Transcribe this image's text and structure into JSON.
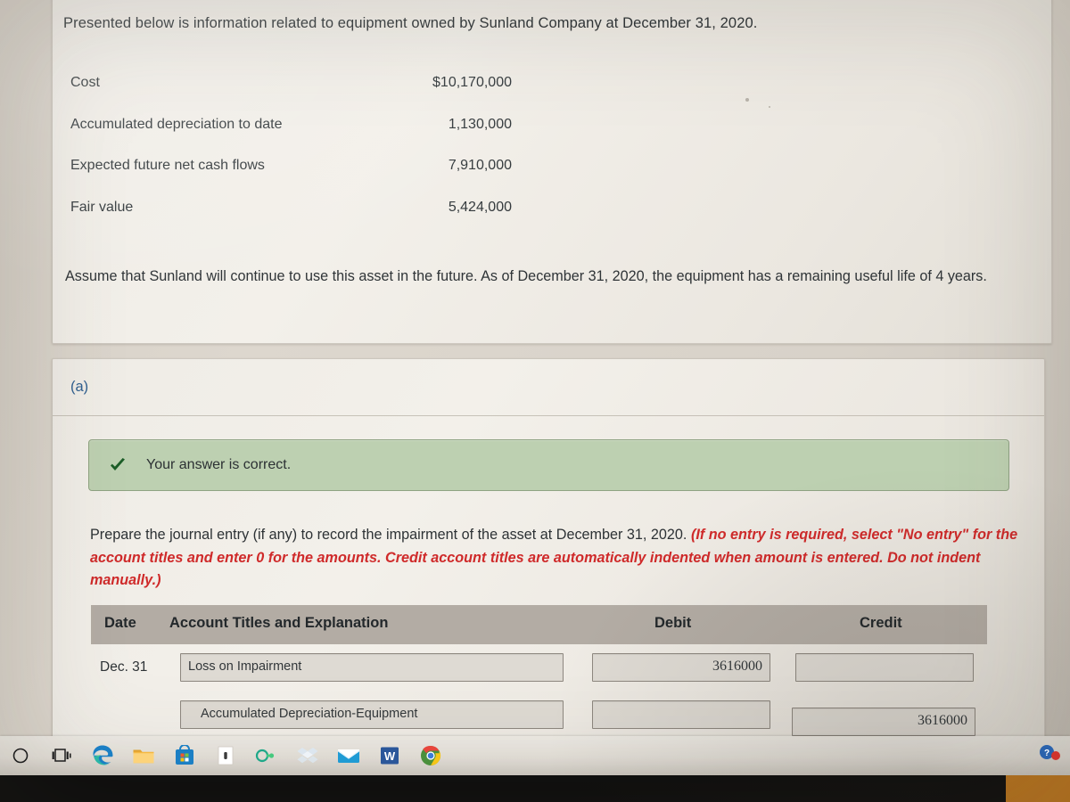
{
  "intro": {
    "text": "Presented below is information related to equipment owned by Sunland Company at December 31, 2020."
  },
  "equipment_info": {
    "rows": [
      {
        "label": "Cost",
        "value": "$10,170,000"
      },
      {
        "label": "Accumulated depreciation to date",
        "value": "1,130,000"
      },
      {
        "label": "Expected future net cash flows",
        "value": "7,910,000"
      },
      {
        "label": "Fair value",
        "value": "5,424,000"
      }
    ]
  },
  "assumption": {
    "text": "Assume that Sunland will continue to use this asset in the future. As of December 31, 2020, the equipment has a remaining useful life of 4 years."
  },
  "part_a": {
    "label": "(a)",
    "feedback": {
      "icon": "check-icon",
      "text": "Your answer is correct.",
      "background_color": "#bdd0b1",
      "border_color": "#8fa383"
    },
    "instruction": {
      "lead": "Prepare the journal entry (if any) to record the impairment of the asset at December 31, 2020.",
      "emphasis": "(If no entry is required, select \"No entry\" for the account titles and enter 0 for the amounts. Credit account titles are automatically indented when amount is entered. Do not indent manually.)",
      "emphasis_color": "#cf2a2a"
    },
    "journal_table": {
      "headers": {
        "date": "Date",
        "account": "Account Titles and Explanation",
        "debit": "Debit",
        "credit": "Credit"
      },
      "header_background": "#b3aca4",
      "rows": [
        {
          "date": "Dec. 31",
          "account": "Loss on Impairment",
          "debit": "3616000",
          "credit": "",
          "indented": false
        },
        {
          "date": "",
          "account": "Accumulated Depreciation-Equipment",
          "debit": "",
          "credit": "3616000",
          "indented": true
        }
      ]
    }
  },
  "taskbar": {
    "items": [
      {
        "name": "cortana-search-icon",
        "label": "Search"
      },
      {
        "name": "task-view-icon",
        "label": "Task View"
      },
      {
        "name": "microsoft-edge-icon",
        "label": "Microsoft Edge"
      },
      {
        "name": "file-explorer-icon",
        "label": "File Explorer"
      },
      {
        "name": "microsoft-store-icon",
        "label": "Microsoft Store"
      },
      {
        "name": "document-app-icon",
        "label": "Document App"
      },
      {
        "name": "office-loop-icon",
        "label": "Office Link"
      },
      {
        "name": "dropbox-icon",
        "label": "Dropbox"
      },
      {
        "name": "mail-icon",
        "label": "Mail"
      },
      {
        "name": "microsoft-word-icon",
        "label": "Microsoft Word"
      },
      {
        "name": "google-chrome-icon",
        "label": "Google Chrome"
      }
    ],
    "tray": {
      "name": "notification-tray-icon",
      "label": "Notifications"
    }
  }
}
